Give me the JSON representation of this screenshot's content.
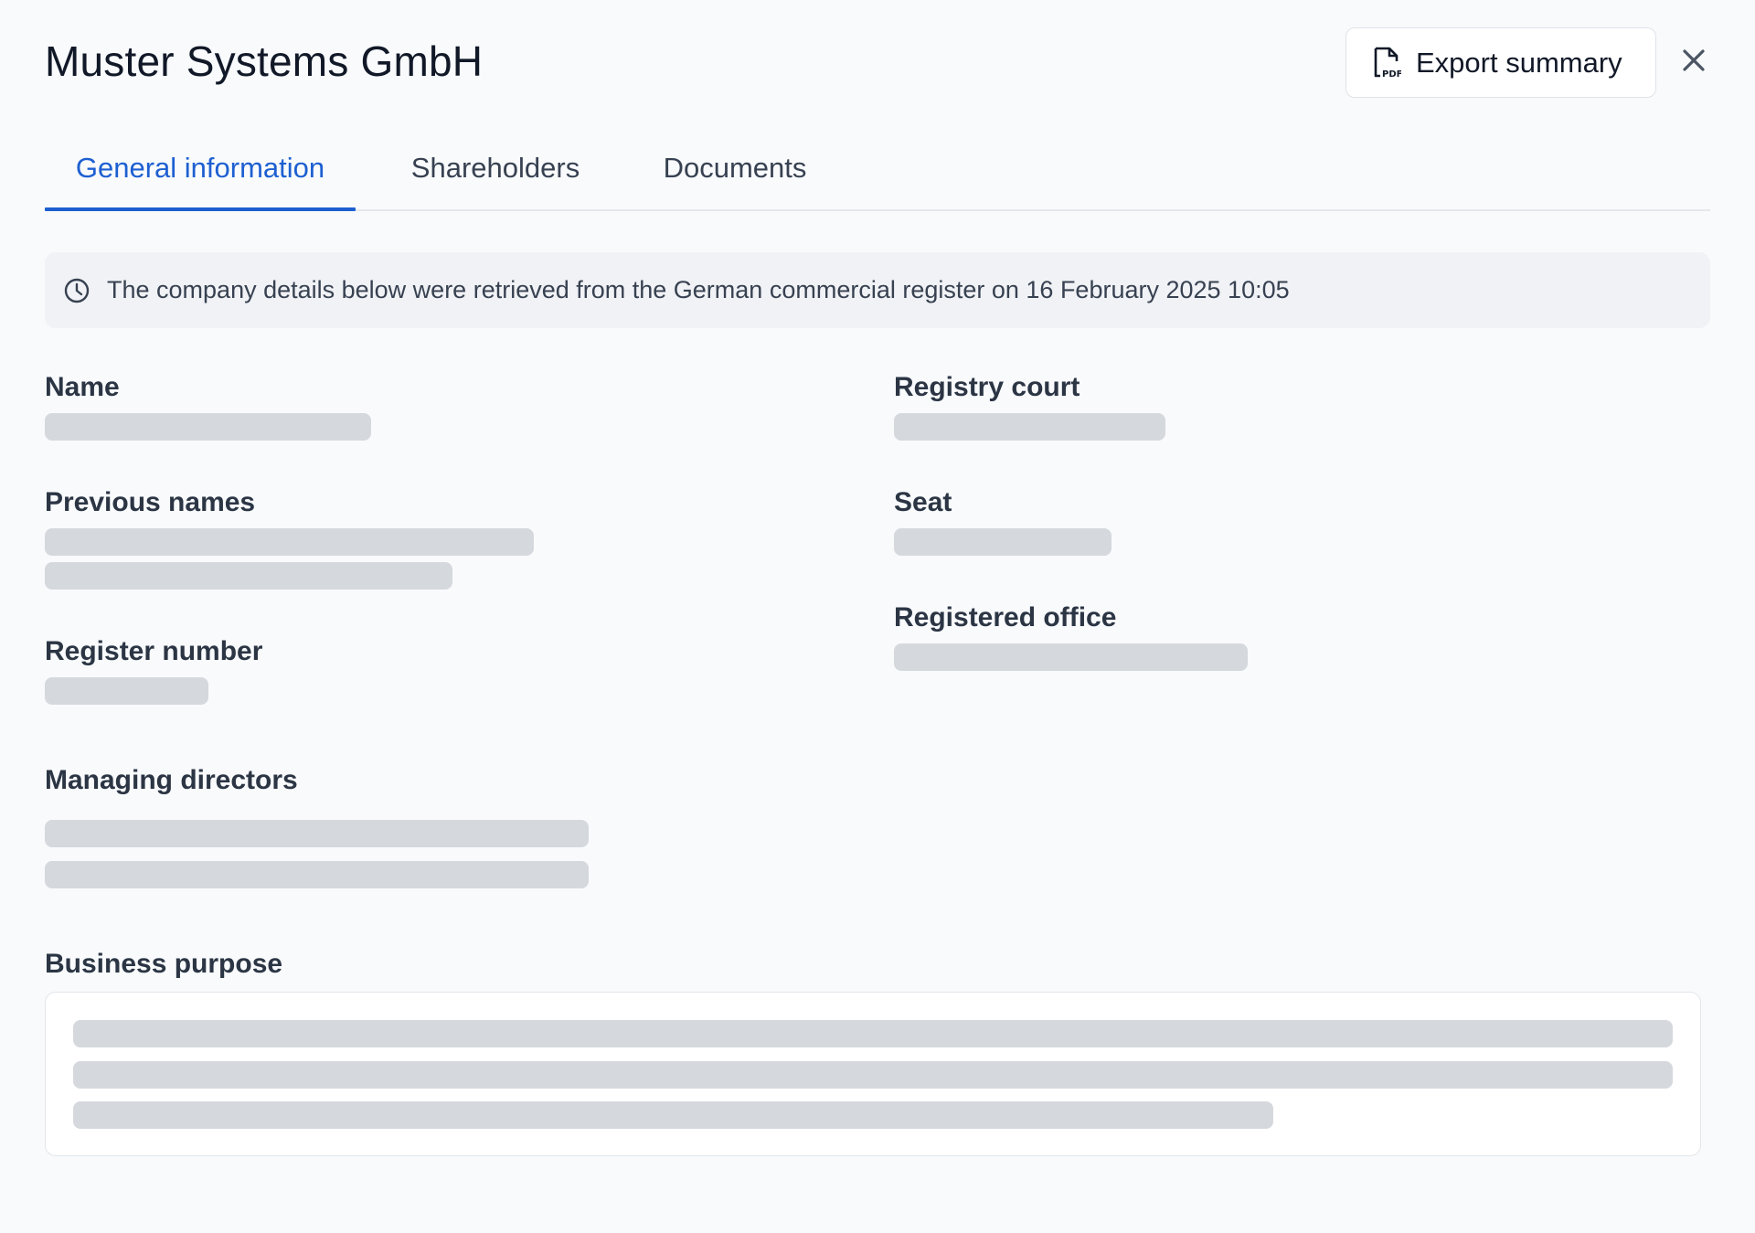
{
  "header": {
    "title": "Muster Systems GmbH",
    "export_label": "Export summary"
  },
  "tabs": [
    {
      "label": "General information",
      "active": true
    },
    {
      "label": "Shareholders",
      "active": false
    },
    {
      "label": "Documents",
      "active": false
    }
  ],
  "notice": {
    "text": "The company details below were retrieved from the German commercial register on 16 February 2025 10:05"
  },
  "fields": {
    "name": "Name",
    "previous_names": "Previous names",
    "register_number": "Register number",
    "managing_directors": "Managing directors",
    "business_purpose": "Business purpose",
    "registry_court": "Registry court",
    "seat": "Seat",
    "registered_office": "Registered office"
  },
  "colors": {
    "accent": "#1d5fd1",
    "skeleton": "#d5d8dd",
    "background": "#f8fafc"
  }
}
